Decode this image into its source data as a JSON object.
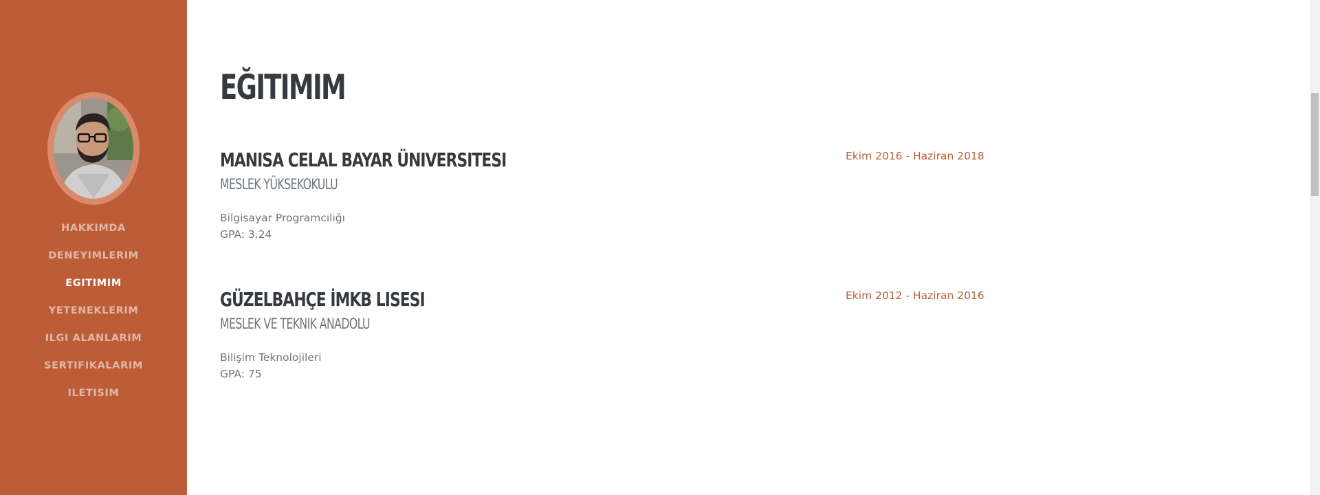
{
  "sidebar": {
    "colors": {
      "background": "#bd5d38",
      "active_text": "#ffffff"
    },
    "nav": [
      {
        "label": "HAKKIMDA",
        "active": false
      },
      {
        "label": "DENEYIMLERIM",
        "active": false
      },
      {
        "label": "EGITIMIM",
        "active": true
      },
      {
        "label": "YETENEKLERIM",
        "active": false
      },
      {
        "label": "ILGI ALANLARIM",
        "active": false
      },
      {
        "label": "SERTIFIKALARIM",
        "active": false
      },
      {
        "label": "ILETISIM",
        "active": false
      }
    ]
  },
  "main": {
    "title": "EĞITIMIM",
    "accent_color": "#bd5d38",
    "entries": [
      {
        "title": "MANISA CELAL BAYAR ÜNIVERSITESI",
        "subtitle": "MESLEK YÜKSEKOKULU",
        "program": "Bilgisayar Programcılığı",
        "gpa": "GPA: 3.24",
        "date": "Ekim 2016 - Haziran 2018"
      },
      {
        "title": "GÜZELBAHÇE İMKB LISESI",
        "subtitle": "MESLEK VE TEKNIK ANADOLU",
        "program": "Bilişim Teknolojileri",
        "gpa": "GPA: 75",
        "date": "Ekim 2012 - Haziran 2016"
      }
    ]
  }
}
